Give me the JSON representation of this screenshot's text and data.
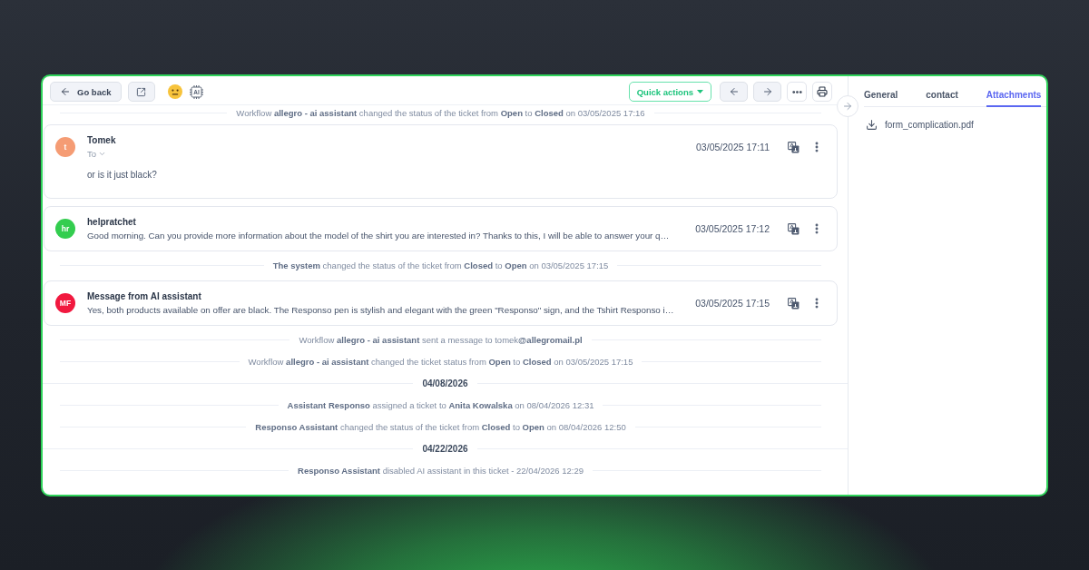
{
  "toolbar": {
    "back_button": {
      "label": "Go back"
    },
    "chip_label": "AI",
    "quick_actions": {
      "label": "Quick actions"
    }
  },
  "timeline": [
    {
      "kind": "system",
      "text": "Workflow **allegro - ai assistant** changed the status of the ticket from **Open** to **Closed** on 03/05/2025 17:16"
    },
    {
      "kind": "message",
      "initials": "t",
      "color": "#f59c74",
      "author": "Tomek",
      "recipient": "To",
      "body": "or is it just black?",
      "time": "03/05/2025 17:11"
    },
    {
      "kind": "message",
      "initials": "hr",
      "color": "#33cd4f",
      "author": "helpratchet",
      "body": "Good morning. Can you provide more information about the model of the shirt you are interested in? Thanks to this, I will be able to answer your q…",
      "time": "03/05/2025 17:12"
    },
    {
      "kind": "system",
      "text": "**The system** changed the status of the ticket from **Closed** to **Open** on 03/05/2025 17:15"
    },
    {
      "kind": "message",
      "initials": "MF",
      "color": "#f1193f",
      "author": "Message from AI assistant",
      "body": "Yes, both products available on offer are black. The Responso pen is stylish and elegant with the green \"Responso\" sign, and the Tshirt Responso i…",
      "time": "03/05/2025 17:15"
    },
    {
      "kind": "system",
      "text": "Workflow **allegro - ai assistant** sent a message to tomek**@allegromail.pl**"
    },
    {
      "kind": "system",
      "text": "Workflow **allegro - ai assistant** changed the ticket status from **Open** to **Closed** on 03/05/2025 17:15"
    },
    {
      "kind": "date",
      "text": "04/08/2026"
    },
    {
      "kind": "system",
      "text": "**Assistant Responso** assigned a ticket to **Anita Kowalska** on 08/04/2026 12:31"
    },
    {
      "kind": "system",
      "text": "**Responso Assistant** changed the status of the ticket from **Closed** to **Open** on 08/04/2026 12:50"
    },
    {
      "kind": "date",
      "text": "04/22/2026"
    },
    {
      "kind": "system",
      "text": "**Responso Assistant** disabled AI assistant in this ticket - 22/04/2026 12:29"
    }
  ],
  "side_panel": {
    "tabs": [
      {
        "label": "General",
        "selected": false
      },
      {
        "label": "contact",
        "selected": false
      },
      {
        "label": "Attachments",
        "selected": true
      }
    ],
    "attachments": [
      {
        "name": "form_complication.pdf"
      }
    ]
  }
}
